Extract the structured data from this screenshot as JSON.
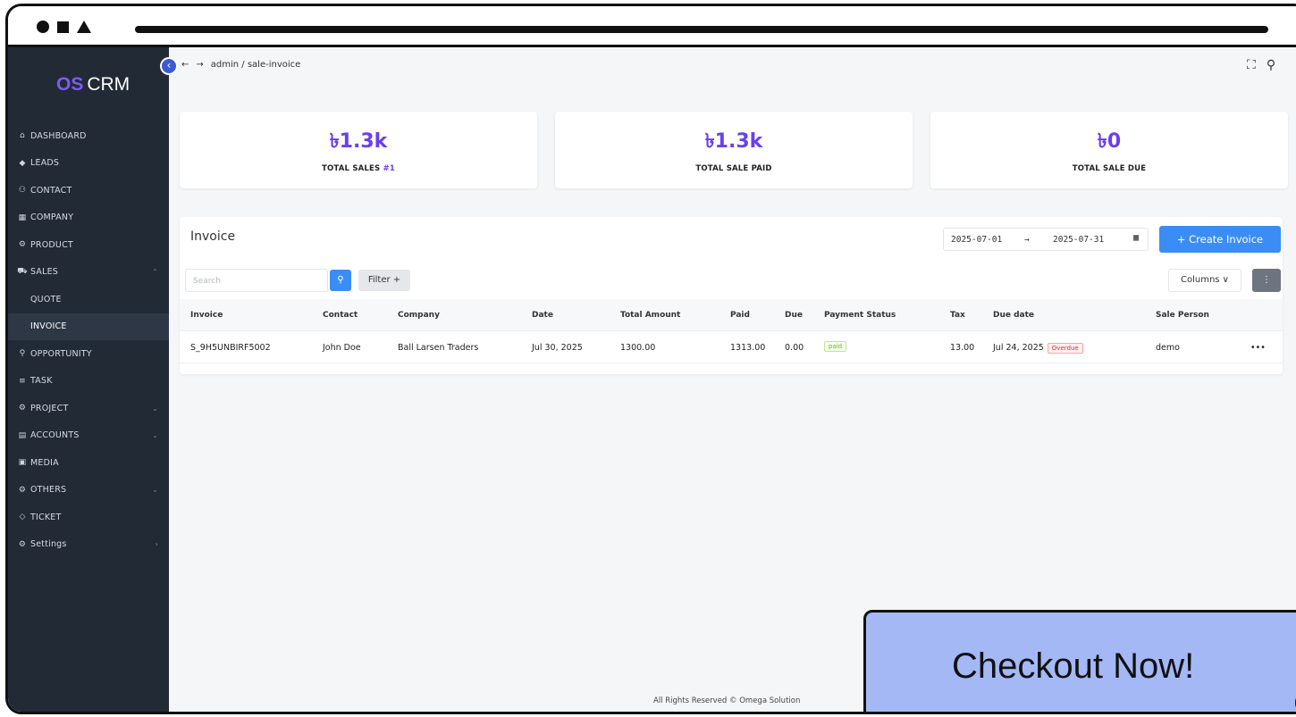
{
  "brand": {
    "prefix": "OS",
    "name": "CRM"
  },
  "breadcrumb": {
    "back": "←",
    "forward": "→",
    "path": "admin / sale-invoice"
  },
  "sidebar": {
    "items": [
      {
        "icon": "⌂",
        "label": "DASHBOARD"
      },
      {
        "icon": "◆",
        "label": "LEADS"
      },
      {
        "icon": "⚇",
        "label": "CONTACT"
      },
      {
        "icon": "▦",
        "label": "COMPANY"
      },
      {
        "icon": "⚙",
        "label": "PRODUCT"
      },
      {
        "icon": "⛟",
        "label": "SALES",
        "chevron": "⌃"
      },
      {
        "label": "QUOTE"
      },
      {
        "label": "INVOICE"
      },
      {
        "icon": "⚲",
        "label": "OPPORTUNITY"
      },
      {
        "icon": "≡",
        "label": "TASK"
      },
      {
        "icon": "⚙",
        "label": "PROJECT",
        "chevron": "⌄"
      },
      {
        "icon": "▤",
        "label": "ACCOUNTS",
        "chevron": "⌄"
      },
      {
        "icon": "▣",
        "label": "MEDIA"
      },
      {
        "icon": "⚙",
        "label": "OTHERS",
        "chevron": "⌄"
      },
      {
        "icon": "◇",
        "label": "TICKET"
      },
      {
        "icon": "⚙",
        "label": "Settings",
        "chevron": "›"
      }
    ]
  },
  "stats": [
    {
      "value": "৳1.3k",
      "label": "TOTAL SALES",
      "hash": "#1"
    },
    {
      "value": "৳1.3k",
      "label": "TOTAL SALE PAID"
    },
    {
      "value": "৳0",
      "label": "TOTAL SALE DUE"
    }
  ],
  "invoice_panel": {
    "title": "Invoice",
    "date_start": "2025-07-01",
    "date_end": "2025-07-31",
    "create_label": "+ Create Invoice",
    "search_placeholder": "Search",
    "filter_label": "Filter +",
    "columns_label": "Columns ∨",
    "kebab": "⋮"
  },
  "table": {
    "headers": [
      "Invoice",
      "Contact",
      "Company",
      "Date",
      "Total Amount",
      "Paid",
      "Due",
      "Payment Status",
      "Tax",
      "Due date",
      "Sale Person"
    ],
    "rows": [
      {
        "invoice": "S_9H5UNBIRF5002",
        "contact": "John Doe",
        "company": "Ball Larsen Traders",
        "date": "Jul 30, 2025",
        "total": "1300.00",
        "paid": "1313.00",
        "due": "0.00",
        "status": "paid",
        "tax": "13.00",
        "due_date": "Jul 24, 2025",
        "due_flag": "Overdue",
        "sale_person": "demo",
        "actions": "•••"
      }
    ]
  },
  "footer": "All Rights Reserved © Omega Solution",
  "checkout": "Checkout Now!",
  "colors": {
    "sidebar": "#222a36",
    "accent": "#6a3ff0",
    "primary": "#3b8df6",
    "checkout_bg": "#a4b8f6"
  }
}
